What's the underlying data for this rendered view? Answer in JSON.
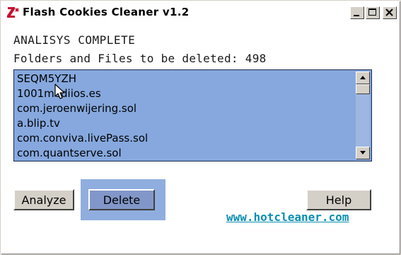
{
  "window": {
    "title": "Flash Cookies Cleaner v1.2",
    "controls": [
      "minimize",
      "maximize",
      "close"
    ]
  },
  "status": {
    "heading": "ANALISYS COMPLETE",
    "count_label": "Folders and Files to be deleted: 498"
  },
  "list": {
    "items": [
      "SEQM5YZH",
      "1001mediios.es",
      "com.jeroenwijering.sol",
      "a.blip.tv",
      "com.conviva.livePass.sol",
      "com.quantserve.sol"
    ]
  },
  "buttons": {
    "analyze": "Analyze",
    "delete": "Delete",
    "help": "Help"
  },
  "link": {
    "text": "www.hotcleaner.com"
  },
  "colors": {
    "list_background": "#86a8de",
    "delete_highlight": "#8faedf",
    "link": "#0b8fb0"
  }
}
